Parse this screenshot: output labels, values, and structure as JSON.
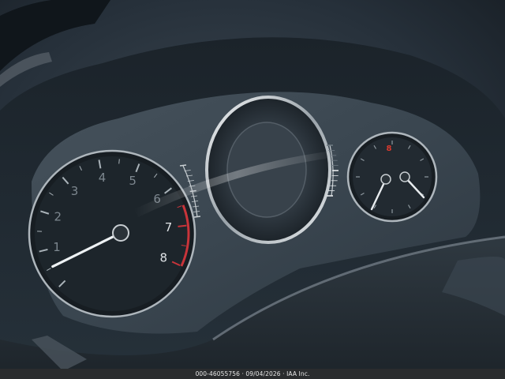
{
  "tachometer": {
    "numerals": [
      "1",
      "2",
      "3",
      "4",
      "5",
      "6",
      "7",
      "8"
    ],
    "redline_from": 6.5,
    "needle_value": 0.6,
    "max": 8
  },
  "fuel_gauge": {
    "level": 0.5
  },
  "clock_gauge": {
    "indicator": "8",
    "indicator_color": "#d83a2e"
  },
  "colors": {
    "cluster_bg": "#2b3640",
    "dial_face": "#1f262c",
    "chrome": "#d9dde0",
    "needle": "#eef2f4",
    "redline": "#c8343a"
  },
  "footer": {
    "text": "000-46055756 · 09/04/2026 · IAA Inc."
  }
}
